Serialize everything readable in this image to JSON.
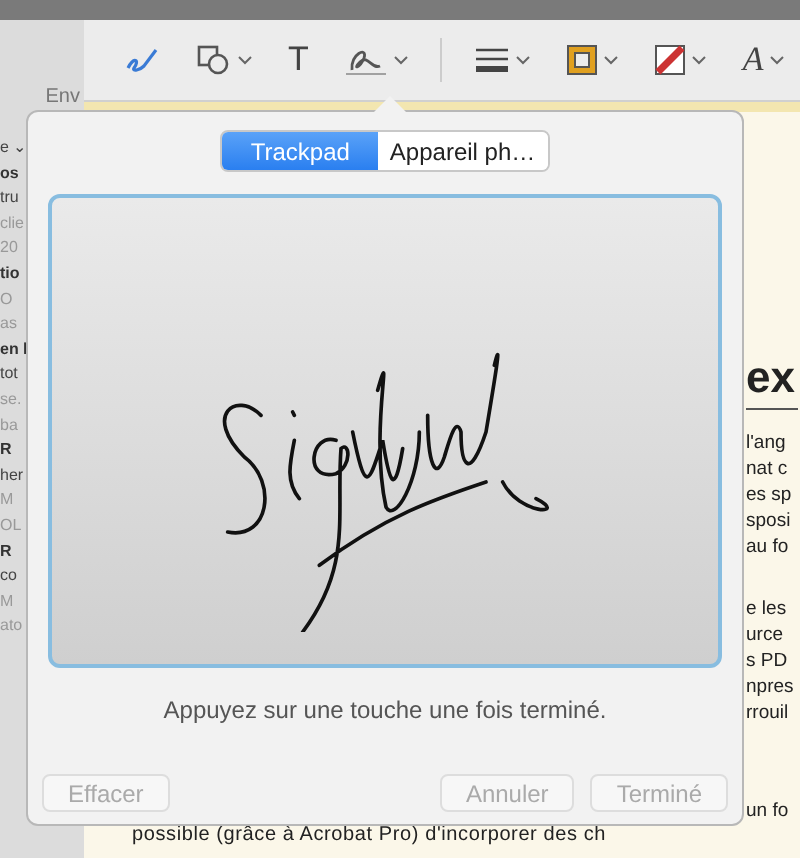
{
  "mail_list": {
    "header": "Env",
    "fragments": [
      {
        "text": "e ⌄",
        "kind": "normal"
      },
      {
        "text": "os",
        "kind": "bold"
      },
      {
        "text": "tru",
        "kind": "normal"
      },
      {
        "text": "clie",
        "kind": "dim"
      },
      {
        "text": "20",
        "kind": "dim"
      },
      {
        "text": "tio",
        "kind": "bold"
      },
      {
        "text": "O",
        "kind": "dim"
      },
      {
        "text": "as",
        "kind": "dim"
      },
      {
        "text": "en l",
        "kind": "bold"
      },
      {
        "text": "tot",
        "kind": "normal"
      },
      {
        "text": "se.",
        "kind": "dim"
      },
      {
        "text": "ba",
        "kind": "dim"
      },
      {
        "text": "R",
        "kind": "bold"
      },
      {
        "text": "her",
        "kind": "normal"
      },
      {
        "text": "M",
        "kind": "dim"
      },
      {
        "text": "OL",
        "kind": "dim"
      },
      {
        "text": "R",
        "kind": "bold"
      },
      {
        "text": "co",
        "kind": "normal"
      },
      {
        "text": "M",
        "kind": "dim"
      },
      {
        "text": "ato",
        "kind": "dim"
      }
    ]
  },
  "toolbar": {
    "tools": [
      {
        "kind": "sketch",
        "menu": false
      },
      {
        "kind": "shapes",
        "menu": true
      },
      {
        "kind": "text",
        "menu": false,
        "glyph": "T"
      },
      {
        "kind": "signature",
        "menu": true
      },
      {
        "kind": "lines",
        "menu": true
      },
      {
        "kind": "border",
        "menu": true,
        "color": "#e0a020"
      },
      {
        "kind": "fill",
        "menu": true,
        "color": "#cc3333"
      },
      {
        "kind": "font",
        "menu": true,
        "glyph": "A"
      }
    ]
  },
  "document": {
    "heading": "ex",
    "paragraphs": [
      [
        "l'ang",
        "nat c",
        "es sp",
        "sposi",
        "au fo"
      ],
      [
        "e les",
        "urce",
        "s PD",
        "npres",
        "rrouil"
      ],
      [
        "un fo"
      ]
    ],
    "full_line": "possible (grâce à Acrobat Pro) d'incorporer des ch"
  },
  "signature_popover": {
    "tabs": [
      {
        "label": "Trackpad",
        "selected": true
      },
      {
        "label": "Appareil ph…",
        "selected": false
      }
    ],
    "hint": "Appuyez sur une touche une fois terminé.",
    "buttons": [
      {
        "label": "Effacer",
        "disabled": true
      },
      {
        "label": "Annuler",
        "disabled": true
      },
      {
        "label": "Terminé",
        "disabled": true
      }
    ]
  }
}
